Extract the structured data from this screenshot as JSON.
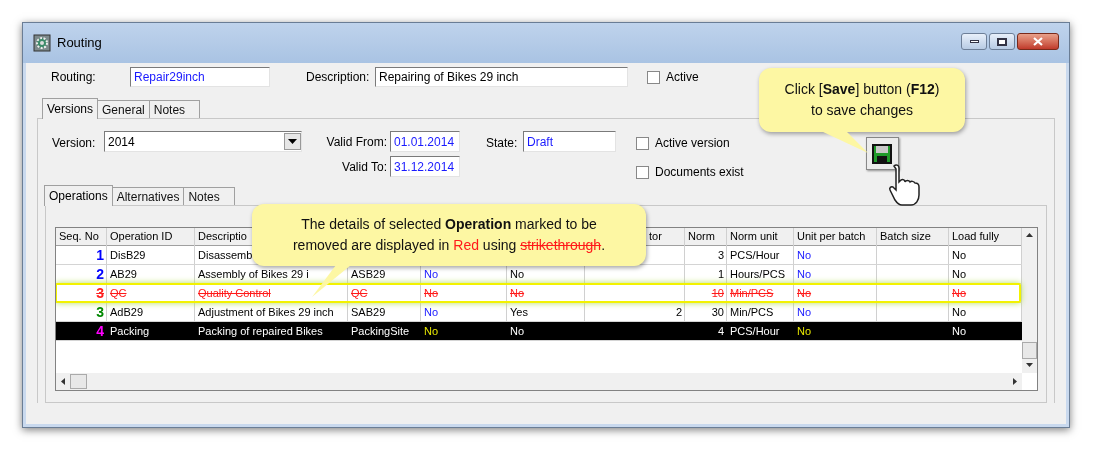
{
  "window": {
    "title": "Routing"
  },
  "header": {
    "routing_label": "Routing:",
    "routing": "Repair29inch",
    "description_label": "Description:",
    "description": "Repairing of Bikes 29 inch",
    "active": {
      "label": "Active",
      "checked": false
    }
  },
  "tabs": [
    {
      "label": "Versions",
      "selected": true
    },
    {
      "label": "General",
      "selected": false
    },
    {
      "label": "Notes",
      "selected": false
    }
  ],
  "version": {
    "version_label": "Version:",
    "version": "2014",
    "valid_from_label": "Valid From:",
    "valid_from": "01.01.2014",
    "valid_to_label": "Valid To:",
    "valid_to": "31.12.2014",
    "state_label": "State:",
    "state": "Draft",
    "checks": [
      {
        "label": "Active version",
        "checked": false
      },
      {
        "label": "Documents exist",
        "checked": false
      }
    ]
  },
  "save_callout": {
    "lines": [
      "Click [**Save**] button (**F12**)",
      "to save changes"
    ]
  },
  "inner_tabs": [
    {
      "label": "Operations",
      "selected": true
    },
    {
      "label": "Alternatives",
      "selected": false
    },
    {
      "label": "Notes",
      "selected": false
    }
  ],
  "table": {
    "columns": [
      {
        "label": "Seq. No",
        "kind": "number"
      },
      {
        "label": "Operation ID",
        "kind": "text"
      },
      {
        "label": "Descriptio",
        "kind": "text"
      },
      {
        "kind": "text"
      },
      {
        "kind": "flag"
      },
      {
        "kind": "text"
      },
      {
        "label": "tor",
        "kind": "number"
      },
      {
        "label": "Norm",
        "kind": "number"
      },
      {
        "label": "Norm unit",
        "kind": "text"
      },
      {
        "label": "Unit per batch",
        "kind": "flag"
      },
      {
        "label": "Batch size",
        "kind": "number"
      },
      {
        "label": "Load fully",
        "kind": "text"
      }
    ],
    "rows": [
      {
        "color": "#0000ff",
        "deleted": false,
        "selected": false,
        "cells": [
          "1",
          "DisB29",
          "Disassemb",
          null,
          null,
          null,
          null,
          "3",
          "PCS/Hour",
          "No",
          null,
          "No"
        ]
      },
      {
        "color": "#0000ff",
        "deleted": false,
        "selected": false,
        "cells": [
          "2",
          "AB29",
          "Assembly of Bikes 29 i",
          "ASB29",
          "No",
          "No",
          null,
          "1",
          "Hours/PCS",
          "No",
          null,
          "No"
        ]
      },
      {
        "color": "#ff2020",
        "deleted": true,
        "selected": false,
        "cells": [
          "3",
          "QC",
          "Quality Control",
          "QC",
          "No",
          "No",
          null,
          "10",
          "Min/PCS",
          "No",
          null,
          "No"
        ]
      },
      {
        "color": "#008800",
        "deleted": false,
        "selected": false,
        "cells": [
          "3",
          "AdB29",
          "Adjustment of Bikes 29 inch",
          "SAB29",
          "No",
          "Yes",
          "2",
          "30",
          "Min/PCS",
          "No",
          null,
          "No"
        ]
      },
      {
        "color": "#ff00ff",
        "deleted": false,
        "selected": true,
        "cells": [
          "4",
          "Packing",
          "Packing of repaired Bikes",
          "PackingSite",
          "No",
          "No",
          null,
          "4",
          "PCS/Hour",
          "No",
          null,
          "No"
        ]
      }
    ]
  },
  "table_callout": {
    "lines": [
      [
        {
          "text": "The details of selected ",
          "kind": "plain"
        },
        {
          "text": "Operation",
          "kind": "bold"
        },
        {
          "text": " marked to be",
          "kind": "plain"
        }
      ],
      [
        {
          "text": "removed are displayed in ",
          "kind": "plain"
        },
        {
          "text": "Red",
          "kind": "red"
        },
        {
          "text": " using ",
          "kind": "plain"
        },
        {
          "text": "strikethrough",
          "kind": "red-strike"
        },
        {
          "text": ".",
          "kind": "plain"
        }
      ]
    ]
  }
}
